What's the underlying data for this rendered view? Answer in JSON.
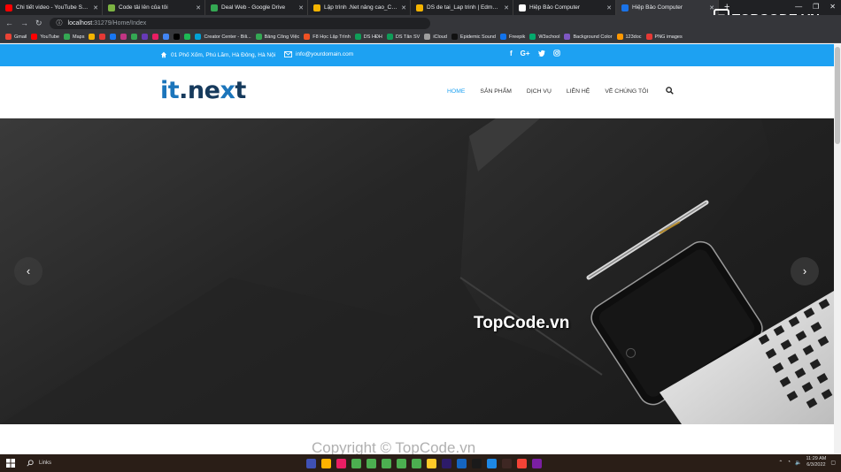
{
  "browser": {
    "tabs": [
      {
        "title": "Chi tiết video - YouTube Studio",
        "color": "#ff0000",
        "active": false
      },
      {
        "title": "Code tải lên của tôi",
        "color": "#7cb342",
        "active": false
      },
      {
        "title": "Deal Web - Google Drive",
        "color": "#34a853",
        "active": false
      },
      {
        "title": "Lập trình .Net nâng cao_CNTT1",
        "color": "#f4b400",
        "active": false
      },
      {
        "title": "DS de tai_Lap trinh | Edmodo",
        "color": "#f4b400",
        "active": false
      },
      {
        "title": "Hiệp Bảo Computer",
        "color": "#ffffff",
        "active": false
      },
      {
        "title": "Hiệp Bảo Computer",
        "color": "#1a73e8",
        "active": true
      }
    ],
    "new_tab": "+",
    "url_host": "localhost",
    "url_path": ":31279/Home/Index",
    "bookmarks": [
      {
        "label": "Gmail",
        "color": "#ea4335"
      },
      {
        "label": "YouTube",
        "color": "#ff0000"
      },
      {
        "label": "Maps",
        "color": "#34a853"
      },
      {
        "label": "",
        "color": "#f4b400"
      },
      {
        "label": "",
        "color": "#e53935"
      },
      {
        "label": "",
        "color": "#1877f2"
      },
      {
        "label": "",
        "color": "#c13584"
      },
      {
        "label": "",
        "color": "#34a853"
      },
      {
        "label": "",
        "color": "#673ab7"
      },
      {
        "label": "",
        "color": "#e91e63"
      },
      {
        "label": "",
        "color": "#4285f4"
      },
      {
        "label": "",
        "color": "#000000"
      },
      {
        "label": "",
        "color": "#1db954"
      },
      {
        "label": "Creator Center - Bili...",
        "color": "#00a1d6"
      },
      {
        "label": "Bảng Công Việc",
        "color": "#34a853"
      },
      {
        "label": "F8 Học Lập Trình",
        "color": "#f05123"
      },
      {
        "label": "DS HĐH",
        "color": "#0f9d58"
      },
      {
        "label": "DS Tân SV",
        "color": "#0f9d58"
      },
      {
        "label": "iCloud",
        "color": "#9e9e9e"
      },
      {
        "label": "Epidemic Sound",
        "color": "#111111"
      },
      {
        "label": "Freepik",
        "color": "#1273eb"
      },
      {
        "label": "W3school",
        "color": "#04aa6d"
      },
      {
        "label": "Background Color",
        "color": "#7e57c2"
      },
      {
        "label": "123doc",
        "color": "#ff9800"
      },
      {
        "label": "PNG images",
        "color": "#e53935"
      }
    ]
  },
  "site": {
    "topbar": {
      "address": "01 Phố Xốm, Phú Lãm, Hà Đông, Hà Nội",
      "email": "info@yourdomain.com",
      "social": [
        "f",
        "G+",
        "twitter",
        "instagram"
      ],
      "color": "#1da1f2"
    },
    "logo": {
      "part1": "it",
      "part2": ".ne",
      "part3": "x",
      "part4": "t"
    },
    "nav": [
      "HOME",
      "SẢN PHẨM",
      "DỊCH VỤ",
      "LIÊN HỆ",
      "VỀ CHÚNG TÔI"
    ],
    "hero": {
      "prev": "‹",
      "next": "›",
      "watermark": "TopCode.vn"
    },
    "copyright": "Copyright © TopCode.vn"
  },
  "brand_overlay": {
    "badge": "T",
    "text": "TOPCODE.VN"
  },
  "taskbar": {
    "search_label": "Links",
    "time": "11:29 AM",
    "date": "6/3/2022",
    "apps": [
      "#3f51b5",
      "#ffb300",
      "#e91e63",
      "#4caf50",
      "#4caf50",
      "#4caf50",
      "#4caf50",
      "#4caf50",
      "#ffca28",
      "#2d1b69",
      "#1565c0",
      "#1a1a1a",
      "#1e88e5",
      "#3e2723",
      "#f44336",
      "#7b1fa2"
    ]
  }
}
